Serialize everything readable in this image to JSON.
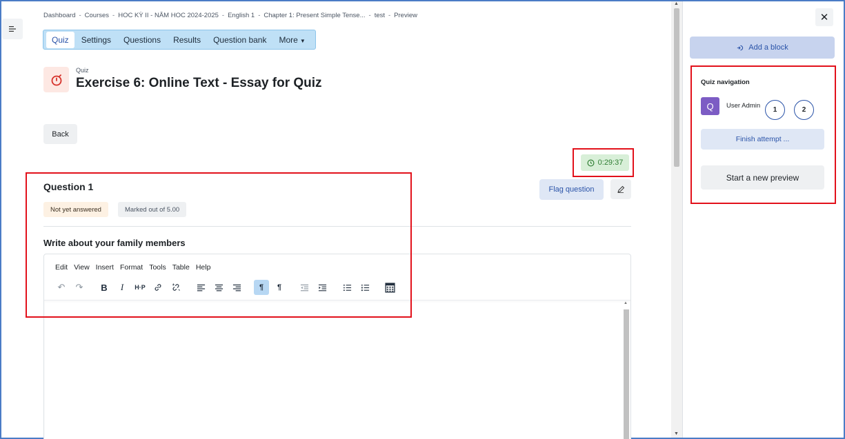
{
  "breadcrumb": [
    "Dashboard",
    "Courses",
    "HOC KỲ II - NĂM HOC 2024-2025",
    "English 1",
    "Chapter 1: Present Simple Tense...",
    "test",
    "Preview"
  ],
  "breadcrumb_sep": "-",
  "tabs": [
    {
      "label": "Quiz",
      "active": true
    },
    {
      "label": "Settings"
    },
    {
      "label": "Questions"
    },
    {
      "label": "Results"
    },
    {
      "label": "Question bank"
    },
    {
      "label": "More"
    }
  ],
  "activity": {
    "kind": "Quiz",
    "title": "Exercise 6: Online Text - Essay for Quiz",
    "icon": "stopwatch-icon"
  },
  "back_label": "Back",
  "timer": "0:29:37",
  "question": {
    "heading": "Question 1",
    "status": "Not yet answered",
    "marks": "Marked out of 5.00",
    "text": "Write about your family members",
    "flag_label": "Flag question"
  },
  "editor": {
    "menu": [
      "Edit",
      "View",
      "Insert",
      "Format",
      "Tools",
      "Table",
      "Help"
    ]
  },
  "drawer": {
    "add_block_label": "Add a block",
    "nav_title": "Quiz navigation",
    "avatar_letter": "Q",
    "user_name": "User Admin",
    "questions": [
      "1",
      "2"
    ],
    "finish_label": "Finish attempt ...",
    "new_preview_label": "Start a new preview"
  },
  "colors": {
    "accent": "#2a53a8",
    "tabs_bg": "#bfe0f6",
    "timer_bg": "#d8efd8",
    "timer_text": "#2e7d32",
    "highlight": "#e2101a",
    "avatar": "#7c5cc4"
  }
}
